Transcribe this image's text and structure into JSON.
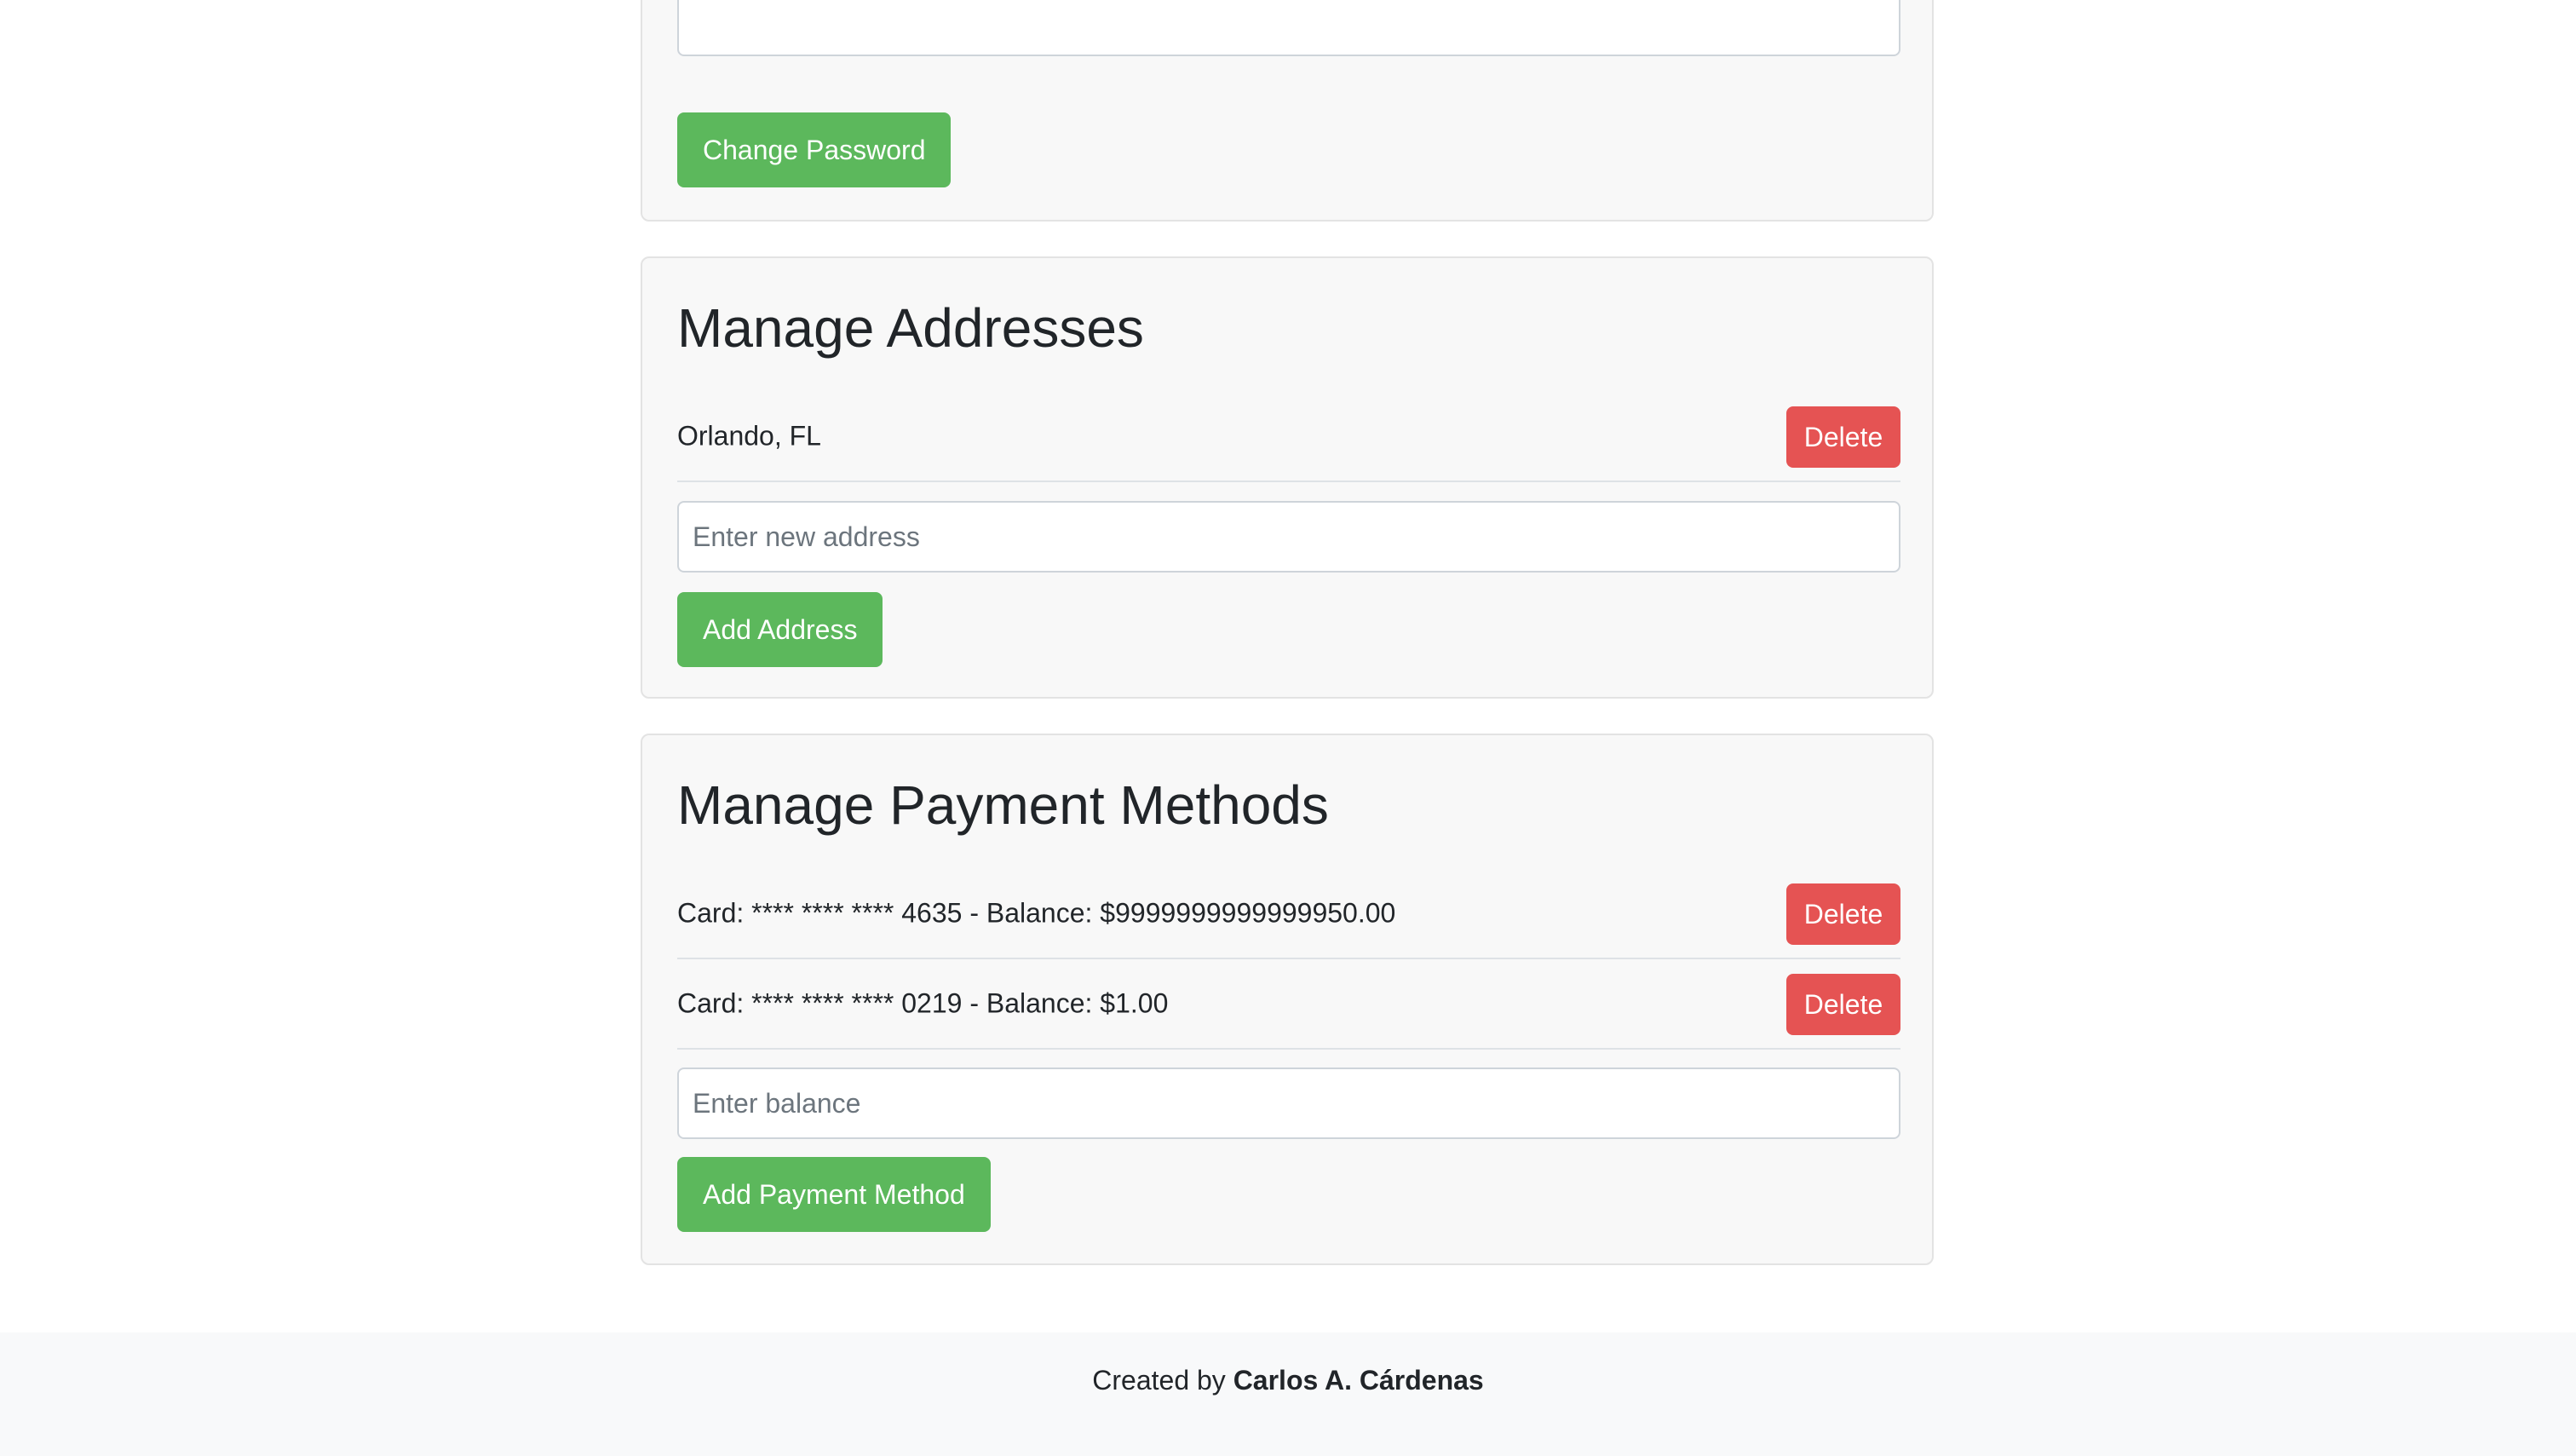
{
  "password_section": {
    "input_value": "",
    "button_label": "Change Password"
  },
  "addresses_section": {
    "title": "Manage Addresses",
    "items": [
      {
        "text": "Orlando, FL",
        "delete_label": "Delete"
      }
    ],
    "input_placeholder": "Enter new address",
    "button_label": "Add Address"
  },
  "payments_section": {
    "title": "Manage Payment Methods",
    "items": [
      {
        "text": "Card: **** **** **** 4635 - Balance: $9999999999999950.00",
        "delete_label": "Delete"
      },
      {
        "text": "Card: **** **** **** 0219 - Balance: $1.00",
        "delete_label": "Delete"
      }
    ],
    "input_placeholder": "Enter balance",
    "button_label": "Add Payment Method"
  },
  "footer": {
    "prefix": "Created by ",
    "author": "Carlos A. Cárdenas"
  },
  "colors": {
    "primary_green": "#5cb85c",
    "danger_red": "#e55353",
    "card_background": "#f8f8f8"
  }
}
